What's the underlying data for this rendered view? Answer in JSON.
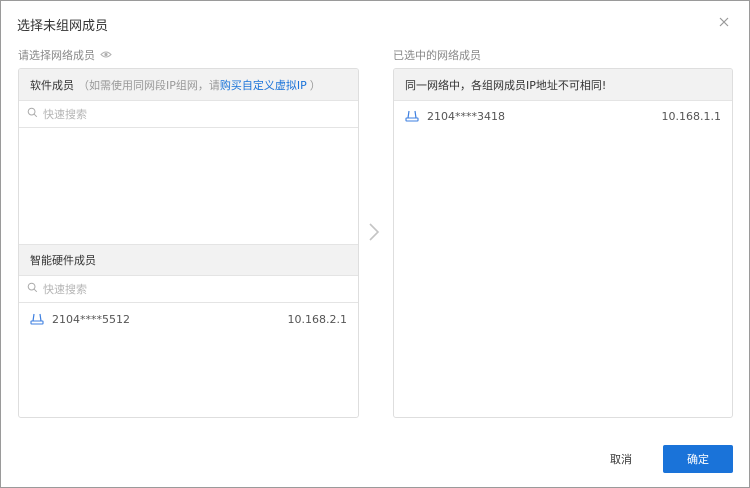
{
  "dialog": {
    "title": "选择未组网成员",
    "close_icon": "close-icon"
  },
  "left": {
    "label": "请选择网络成员",
    "label_icon": "eye-icon",
    "software": {
      "title": "软件成员",
      "hint": "（如需使用同网段IP组网，请",
      "link": "购买自定义虚拟IP",
      "hint_end": "）",
      "search_placeholder": "快速搜索",
      "search_value": ""
    },
    "hardware": {
      "title": "智能硬件成员",
      "search_placeholder": "快速搜索",
      "search_value": "",
      "members": [
        {
          "id": "2104****5512",
          "ip": "10.168.2.1",
          "icon": "router-icon"
        }
      ]
    }
  },
  "transfer": {
    "icon": "chevron-right-icon"
  },
  "right": {
    "label": "已选中的网络成员",
    "notice": "同一网络中，各组网成员IP地址不可相同!",
    "members": [
      {
        "id": "2104****3418",
        "ip": "10.168.1.1",
        "icon": "router-icon"
      }
    ]
  },
  "footer": {
    "cancel_label": "取消",
    "ok_label": "确定"
  },
  "colors": {
    "accent": "#1a73d9",
    "header_bg": "#f2f2f2",
    "border": "#dedede"
  }
}
